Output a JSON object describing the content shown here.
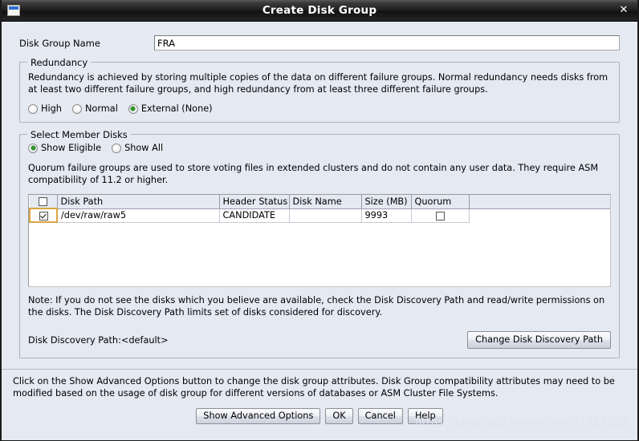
{
  "window": {
    "title": "Create Disk Group",
    "icon": "window-icon",
    "close_label": "✕"
  },
  "disk_group_name": {
    "label": "Disk Group Name",
    "value": "FRA",
    "placeholder": ""
  },
  "redundancy": {
    "legend": "Redundancy",
    "description": "Redundancy is achieved by storing multiple copies of the data on different failure groups. Normal redundancy needs disks from at least two different failure groups, and high redundancy from at least three different failure groups.",
    "options": [
      {
        "label": "High",
        "selected": false
      },
      {
        "label": "Normal",
        "selected": false
      },
      {
        "label": "External (None)",
        "selected": true
      }
    ]
  },
  "member_disks": {
    "legend": "Select Member Disks",
    "filter_options": [
      {
        "label": "Show Eligible",
        "selected": true
      },
      {
        "label": "Show All",
        "selected": false
      }
    ],
    "description": "Quorum failure groups are used to store voting files in extended clusters and do not contain any user data. They require ASM compatibility of 11.2 or higher.",
    "columns": [
      "",
      "Disk Path",
      "Header Status",
      "Disk Name",
      "Size (MB)",
      "Quorum",
      ""
    ],
    "header_select_all": false,
    "rows": [
      {
        "selected": true,
        "disk_path": "/dev/raw/raw5",
        "header_status": "CANDIDATE",
        "disk_name": "",
        "size_mb": "9993",
        "quorum": false
      }
    ],
    "note": "Note: If you do not see the disks which you believe are available, check the Disk Discovery Path and read/write permissions on the disks. The Disk Discovery Path limits set of disks considered for discovery.",
    "discovery_path_label": "Disk Discovery Path:<default>",
    "change_discovery_button": "Change Disk Discovery Path"
  },
  "footer": {
    "text": "Click on the Show Advanced Options button to change the disk group attributes. Disk Group compatibility attributes may need to be modified based on the usage of disk group for different versions of databases or ASM Cluster File Systems.",
    "buttons": [
      {
        "label": "Show Advanced Options",
        "name": "show-advanced-options-button"
      },
      {
        "label": "OK",
        "name": "ok-button"
      },
      {
        "label": "Cancel",
        "name": "cancel-button"
      },
      {
        "label": "Help",
        "name": "help-button"
      }
    ]
  },
  "watermark": "https://blog.csdn.net/weixin_37423880",
  "colors": {
    "dialog_background": "#e4e9f2",
    "titlebar": "#1c1c1c",
    "radio_selected": "#2e9b2e",
    "focus_border": "#d9a544",
    "table_background": "#ffffff"
  }
}
